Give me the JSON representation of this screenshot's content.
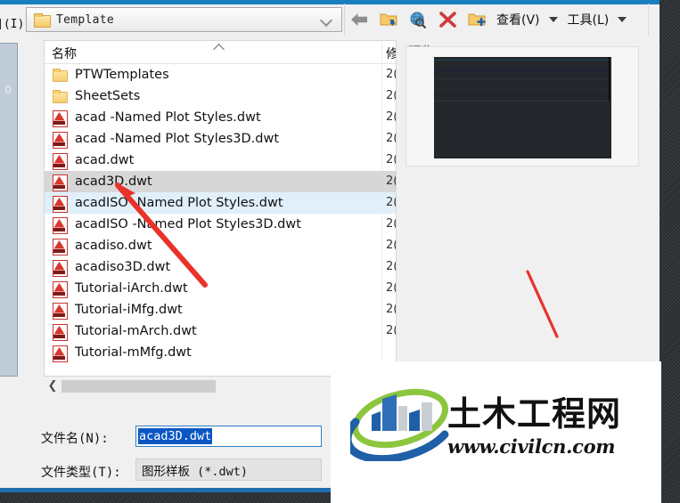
{
  "window": {
    "accent_color": "#1a7fc1",
    "backdrop_color": "#2e3234"
  },
  "lookin": {
    "label": "](I):",
    "value": "Template",
    "folder_icon": "folder-icon",
    "chevron_icon": "chevron-down-icon"
  },
  "toolbar": {
    "items": [
      {
        "name": "back-button",
        "icon": "back-arrow-icon",
        "label": ""
      },
      {
        "name": "up-one-level-button",
        "icon": "folder-up-icon",
        "label": ""
      },
      {
        "name": "search-web-button",
        "icon": "globe-search-icon",
        "label": ""
      },
      {
        "name": "delete-button",
        "icon": "delete-x-icon",
        "label": ""
      },
      {
        "name": "new-folder-button",
        "icon": "folder-new-icon",
        "label": ""
      }
    ],
    "view_menu": "查看(V)",
    "tools_menu": "工具(L)",
    "caret_icon": "caret-down-icon"
  },
  "places": {
    "item_label": "0"
  },
  "filelist": {
    "columns": [
      "名称",
      "修"
    ],
    "rows": [
      {
        "name": "PTWTemplates",
        "type": "folder",
        "modified": "2(",
        "state": "none"
      },
      {
        "name": "SheetSets",
        "type": "folder",
        "modified": "2(",
        "state": "none"
      },
      {
        "name": "acad -Named Plot Styles.dwt",
        "type": "dwt",
        "modified": "2(",
        "state": "none"
      },
      {
        "name": "acad -Named Plot Styles3D.dwt",
        "type": "dwt",
        "modified": "2(",
        "state": "none"
      },
      {
        "name": "acad.dwt",
        "type": "dwt",
        "modified": "2(",
        "state": "none"
      },
      {
        "name": "acad3D.dwt",
        "type": "dwt",
        "modified": "2(",
        "state": "hover"
      },
      {
        "name": "acadISO -Named Plot Styles.dwt",
        "type": "dwt",
        "modified": "2(",
        "state": "selected"
      },
      {
        "name": "acadISO -Named Plot Styles3D.dwt",
        "type": "dwt",
        "modified": "2(",
        "state": "none"
      },
      {
        "name": "acadiso.dwt",
        "type": "dwt",
        "modified": "2(",
        "state": "none"
      },
      {
        "name": "acadiso3D.dwt",
        "type": "dwt",
        "modified": "2(",
        "state": "none"
      },
      {
        "name": "Tutorial-iArch.dwt",
        "type": "dwt",
        "modified": "2(",
        "state": "none"
      },
      {
        "name": "Tutorial-iMfg.dwt",
        "type": "dwt",
        "modified": "2(",
        "state": "none"
      },
      {
        "name": "Tutorial-mArch.dwt",
        "type": "dwt",
        "modified": "2(",
        "state": "none"
      },
      {
        "name": "Tutorial-mMfg.dwt",
        "type": "dwt",
        "modified": "",
        "state": "none"
      }
    ],
    "scroll_left_icon": "chevron-left-icon"
  },
  "preview": {
    "label": "预览"
  },
  "form": {
    "filename_label": "文件名(N):",
    "filename_value": "acad3D.dwt",
    "filetype_label": "文件类型(T):",
    "filetype_value": "图形样板 (*.dwt)"
  },
  "watermark": {
    "brand_cn": "土木工程网",
    "site": "www.civilcn.com",
    "logo_icon": "civilcn-logo-icon",
    "logo_green": "#8cc63e",
    "logo_blue": "#1f5fa8"
  },
  "annotations": {
    "arrow_color": "#e8322a",
    "arrow_target": "acad3D.dwt"
  }
}
